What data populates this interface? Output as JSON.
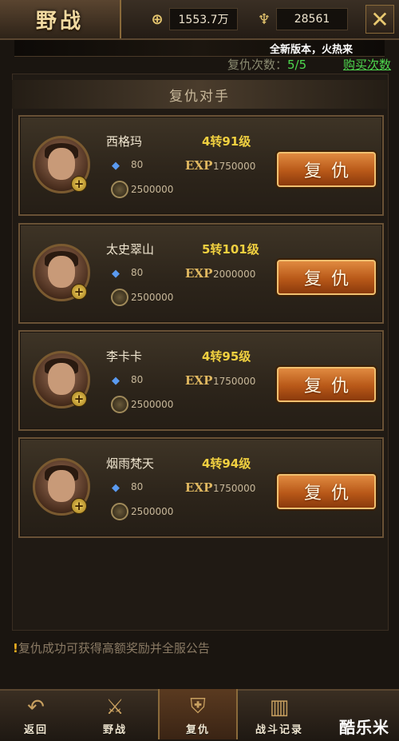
{
  "header": {
    "title": "野战",
    "gold_value": "1553.7万",
    "ingot_value": "28561"
  },
  "marquee_text": "全新版本，火热来",
  "revenge_count": {
    "label": "复仇次数：",
    "value": "5/5"
  },
  "buy_link": "购买次数",
  "panel_title": "复仇对手",
  "opponents": [
    {
      "name": "西格玛",
      "level": "4转91级",
      "stat_a": "80",
      "exp_label": "EXP",
      "exp": "1750000",
      "coins": "2500000",
      "button": "复仇"
    },
    {
      "name": "太史翠山",
      "level": "5转101级",
      "stat_a": "80",
      "exp_label": "EXP",
      "exp": "2000000",
      "coins": "2500000",
      "button": "复仇"
    },
    {
      "name": "李卡卡",
      "level": "4转95级",
      "stat_a": "80",
      "exp_label": "EXP",
      "exp": "1750000",
      "coins": "2500000",
      "button": "复仇"
    },
    {
      "name": "烟雨梵天",
      "level": "4转94级",
      "stat_a": "80",
      "exp_label": "EXP",
      "exp": "1750000",
      "coins": "2500000",
      "button": "复仇"
    }
  ],
  "notice": "复仇成功可获得高额奖励并全服公告",
  "nav": {
    "back": "返回",
    "field_battle": "野战",
    "revenge": "复仇",
    "battle_log": "战斗记录"
  },
  "watermark": "酷乐米",
  "icons": {
    "gold": "gold-plus-icon",
    "ingot": "ingot-icon",
    "close": "close-icon",
    "stat_a": "gem-icon",
    "coin": "coin-icon"
  },
  "colors": {
    "level": "#f0d040",
    "count_value": "#4ed84e",
    "button": "#b85818"
  }
}
